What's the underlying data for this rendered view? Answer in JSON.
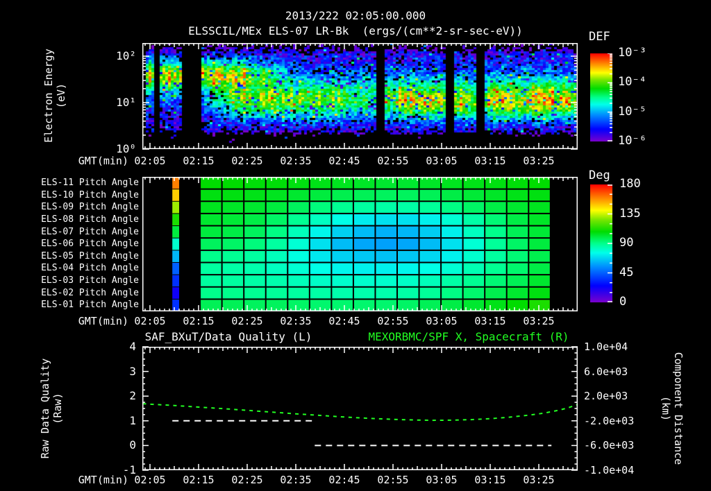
{
  "header": {
    "title": "2013/222 02:05:00.000",
    "subtitle": "ELSSCIL/MEx ELS-07 LR-Bk  (ergs/(cm**2-sr-sec-eV))"
  },
  "time_axis": {
    "label": "GMT(min)",
    "ticks": [
      "02:05",
      "02:15",
      "02:25",
      "02:35",
      "02:45",
      "02:55",
      "03:05",
      "03:15",
      "03:25"
    ]
  },
  "axis_labels": {
    "electron_line1": "Electron Energy",
    "electron_line2": "(eV)",
    "raw_line1": "Raw Data Quality",
    "raw_line2": "(Raw)",
    "comp_line1": "Component Distance",
    "comp_line2": "(km)"
  },
  "colors": {
    "background": "#000000",
    "text": "#ffffff",
    "accent_green": "#22ff22",
    "frame": "#ffffff",
    "rainbow_stops": [
      [
        0,
        "#7a00cc"
      ],
      [
        0.14,
        "#0000ff"
      ],
      [
        0.3,
        "#008cff"
      ],
      [
        0.42,
        "#00ffea"
      ],
      [
        0.5,
        "#00ff8c"
      ],
      [
        0.6,
        "#00dc00"
      ],
      [
        0.7,
        "#78e600"
      ],
      [
        0.78,
        "#ffff00"
      ],
      [
        0.87,
        "#ff9600"
      ],
      [
        1,
        "#ff0000"
      ]
    ]
  },
  "chart_data": [
    {
      "type": "heatmap",
      "name": "electron_energy_spectrogram",
      "title": "ELSSCIL/MEx ELS-07 LR-Bk",
      "units": "ergs/(cm**2-sr-sec-eV)",
      "xlabel": "GMT(min)",
      "x_ticks": [
        "02:05",
        "02:15",
        "02:25",
        "02:35",
        "02:45",
        "02:55",
        "03:05",
        "03:15",
        "03:25"
      ],
      "x_range_minutes_after_0205": [
        -1.6,
        88.0
      ],
      "ylabel": "Electron Energy (eV)",
      "y_scale": "log",
      "ylim_eV": [
        1,
        190
      ],
      "y_tick_labels": [
        "10²",
        "10¹",
        "10⁰"
      ],
      "colorbar": {
        "title": "DEF",
        "labels": [
          "10⁻³",
          "10⁻⁴",
          "10⁻⁵",
          "10⁻⁶"
        ],
        "scale": "log",
        "range": [
          1e-06,
          0.001
        ]
      },
      "data_gaps_min": [
        [
          0.3,
          1.7
        ],
        [
          6.4,
          10.1
        ],
        [
          46.3,
          48.0
        ],
        [
          60.3,
          62.0
        ],
        [
          67.0,
          68.4
        ]
      ],
      "features": [
        {
          "desc": "intense electron band",
          "t_min": [
            -1.6,
            16
          ],
          "fade_to_min": 30,
          "energy_eV": [
            15,
            90
          ],
          "peak_logE": 1.62,
          "peak_def": 0.00015
        },
        {
          "desc": "mid-energy photoelectron band",
          "t_min": [
            10,
            88
          ],
          "energy_eV": [
            4,
            25
          ],
          "peak_logE": 1.05,
          "peak_def": 4e-05,
          "enhancements_t_min": [
            [
              50,
              60
            ],
            [
              62,
              66
            ],
            [
              70,
              86
            ]
          ],
          "depletion_t_min": [
            40,
            48
          ]
        },
        {
          "desc": "diffuse blue background",
          "energy_eV": [
            2,
            150
          ],
          "def": 3e-06
        }
      ],
      "background_def": 1e-06
    },
    {
      "type": "heatmap",
      "name": "pitch_angle_panels",
      "rows": [
        "ELS-11 Pitch Angle",
        "ELS-10 Pitch Angle",
        "ELS-09 Pitch Angle",
        "ELS-08 Pitch Angle",
        "ELS-07 Pitch Angle",
        "ELS-06 Pitch Angle",
        "ELS-05 Pitch Angle",
        "ELS-04 Pitch Angle",
        "ELS-03 Pitch Angle",
        "ELS-02 Pitch Angle",
        "ELS-01 Pitch Angle"
      ],
      "colorbar": {
        "title": "Deg",
        "labels": [
          "180",
          "135",
          "90",
          "45",
          "0"
        ],
        "range": [
          0,
          180
        ]
      },
      "lead_column_t_min": [
        4.6,
        6.0
      ],
      "lead_column_deg": [
        160,
        148,
        130,
        112,
        100,
        80,
        62,
        45,
        35,
        22,
        35
      ],
      "grid_t_min": [
        10.3,
        82.4
      ],
      "grid_deg": [
        [
          108,
          108,
          107,
          107,
          106,
          105,
          104,
          103,
          102,
          102,
          103,
          104,
          105,
          106,
          107,
          108
        ],
        [
          106,
          106,
          105,
          104,
          102,
          100,
          98,
          97,
          96,
          96,
          97,
          99,
          101,
          103,
          105,
          106
        ],
        [
          104,
          103,
          102,
          100,
          96,
          92,
          89,
          87,
          86,
          86,
          88,
          91,
          95,
          99,
          102,
          104
        ],
        [
          102,
          101,
          99,
          95,
          89,
          82,
          76,
          72,
          70,
          70,
          73,
          79,
          86,
          93,
          99,
          103
        ],
        [
          100,
          99,
          96,
          91,
          83,
          74,
          67,
          63,
          61,
          62,
          66,
          73,
          82,
          90,
          97,
          101
        ],
        [
          96,
          95,
          92,
          87,
          79,
          70,
          63,
          59,
          58,
          59,
          63,
          70,
          79,
          88,
          95,
          100
        ],
        [
          90,
          89,
          87,
          83,
          77,
          71,
          67,
          65,
          64,
          65,
          68,
          73,
          80,
          87,
          93,
          98
        ],
        [
          87,
          86,
          85,
          82,
          79,
          76,
          74,
          73,
          73,
          74,
          76,
          79,
          84,
          89,
          94,
          99
        ],
        [
          87,
          87,
          86,
          85,
          83,
          81,
          80,
          80,
          80,
          81,
          83,
          86,
          89,
          93,
          97,
          102
        ],
        [
          90,
          90,
          89,
          88,
          87,
          86,
          85,
          85,
          85,
          86,
          88,
          91,
          94,
          98,
          102,
          106
        ],
        [
          97,
          97,
          96,
          96,
          95,
          94,
          94,
          94,
          94,
          95,
          97,
          99,
          102,
          105,
          108,
          112
        ]
      ],
      "no_data_t_min": [
        [
          -1.6,
          4.6
        ],
        [
          6.0,
          10.3
        ],
        [
          82.4,
          88.0
        ]
      ]
    },
    {
      "type": "line",
      "name": "data_quality_and_spacecraft_x",
      "title_left": "SAF_BXuT/Data Quality (L)",
      "title_right": "MEXORBMC/SPF X, Spacecraft (R)",
      "left_axis": {
        "label": "Raw Data Quality (Raw)",
        "lim": [
          -1,
          4
        ],
        "ticks": [
          "4",
          "3",
          "2",
          "1",
          "0",
          "-1"
        ]
      },
      "right_axis": {
        "label": "Component Distance (km)",
        "lim": [
          -10000,
          10000
        ],
        "ticks": [
          "1.0e+04",
          "6.0e+03",
          "2.0e+03",
          "-2.0e+03",
          "-6.0e+03",
          "-1.0e+04"
        ]
      },
      "series": [
        {
          "name": "SAF_BXuT raw data quality",
          "axis": "left",
          "color": "#ffffff",
          "line_style": "dashed",
          "segments": [
            {
              "t_min": [
                4.6,
                33.4
              ],
              "value": 1
            },
            {
              "t_min": [
                33.9,
                82.6
              ],
              "value": 0
            }
          ]
        },
        {
          "name": "MEXORBMC/SPF X spacecraft position",
          "axis": "right",
          "color": "#22ff22",
          "line_style": "dashed",
          "points_t_km": [
            [
              -1.5,
              780
            ],
            [
              0,
              700
            ],
            [
              5,
              480
            ],
            [
              10,
              230
            ],
            [
              15,
              -20
            ],
            [
              20,
              -300
            ],
            [
              25,
              -580
            ],
            [
              30,
              -860
            ],
            [
              35,
              -1120
            ],
            [
              40,
              -1380
            ],
            [
              45,
              -1600
            ],
            [
              50,
              -1760
            ],
            [
              55,
              -1880
            ],
            [
              58,
              -1920
            ],
            [
              62,
              -1900
            ],
            [
              66,
              -1810
            ],
            [
              70,
              -1650
            ],
            [
              74,
              -1400
            ],
            [
              78,
              -1080
            ],
            [
              81,
              -760
            ],
            [
              84,
              -300
            ],
            [
              86,
              100
            ],
            [
              88,
              650
            ]
          ]
        }
      ]
    }
  ]
}
